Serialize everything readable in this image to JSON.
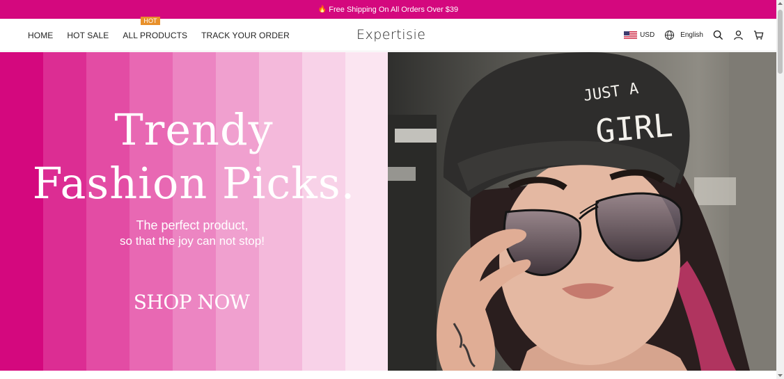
{
  "announcement": {
    "text": "Free Shipping On All Orders Over $39",
    "icon": "flame-icon"
  },
  "nav": {
    "items": [
      {
        "label": "HOME"
      },
      {
        "label": "HOT SALE"
      },
      {
        "label": "ALL PRODUCTS",
        "badge": "HOT"
      },
      {
        "label": "TRACK YOUR ORDER"
      }
    ]
  },
  "logo": "Expertisie",
  "tools": {
    "currency": "USD",
    "language": "English"
  },
  "hero": {
    "title_line1": "Trendy",
    "title_line2": "Fashion Picks.",
    "subtitle_line1": "The perfect product,",
    "subtitle_line2": "so that the joy can not stop!",
    "cta": "SHOP NOW",
    "image_text_line1": "JUST A",
    "image_text_line2": "GIRL"
  },
  "colors": {
    "brand": "#d4087e",
    "badge": "#e8902a",
    "stripes": [
      "#d4087e",
      "#dc2d93",
      "#e34ca4",
      "#e868b3",
      "#ec85c2",
      "#f0a0cf",
      "#f4b9db",
      "#f8d2e8",
      "#fbe5f1"
    ]
  }
}
